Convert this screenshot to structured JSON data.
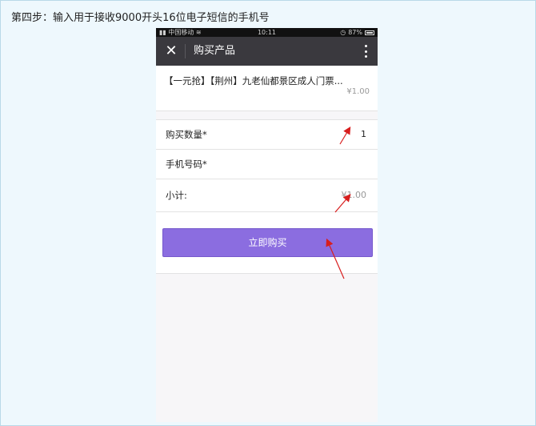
{
  "instruction": "第四步：输入用于接收9000开头16位电子短信的手机号",
  "statusbar": {
    "carrier": "中国移动",
    "time": "10:11",
    "battery": "87%"
  },
  "navbar": {
    "title": "购买产品"
  },
  "product": {
    "title": "【一元抢】【荆州】九老仙都景区成人门票...",
    "price": "¥1.00"
  },
  "form": {
    "quantity_label": "购买数量*",
    "quantity_value": "1",
    "phone_label": "手机号码*",
    "phone_value": "",
    "subtotal_label": "小计:",
    "subtotal_value": "¥1.00"
  },
  "buy_button": {
    "label": "立即购买"
  },
  "colors": {
    "page_bg": "#eef8fd",
    "navbar_bg": "#3a393e",
    "button_bg": "#8b6de0",
    "arrow": "#d81e1e"
  },
  "icons": [
    "close-icon",
    "more-icon",
    "wifi-icon",
    "battery-icon",
    "alarm-icon",
    "signal-icon"
  ]
}
